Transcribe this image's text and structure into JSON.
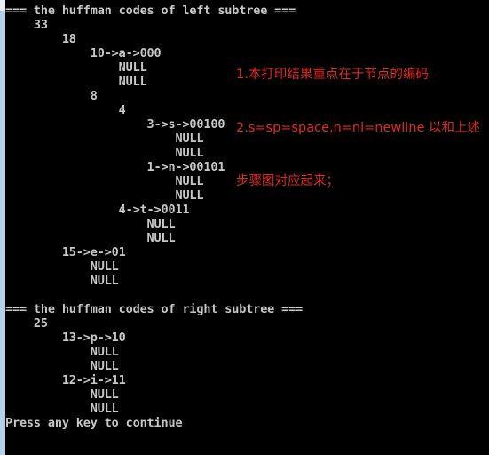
{
  "window": {
    "type": "console",
    "background_color": "#000000",
    "text_color": "#c8c8c8",
    "chrome_edge_color": "#b6d0ea",
    "chrome_edge_highlight_color": "#e7eef6"
  },
  "console": {
    "lines": [
      "=== the huffman codes of left subtree ===",
      "    33",
      "        18",
      "            10->a->000",
      "                NULL",
      "                NULL",
      "            8",
      "                4",
      "                    3->s->00100",
      "                        NULL",
      "                        NULL",
      "                    1->n->00101",
      "                        NULL",
      "                        NULL",
      "                4->t->0011",
      "                    NULL",
      "                    NULL",
      "        15->e->01",
      "            NULL",
      "            NULL",
      "",
      "=== the huffman codes of right subtree ===",
      "    25",
      "        13->p->10",
      "            NULL",
      "            NULL",
      "        12->i->11",
      "            NULL",
      "            NULL",
      "Press any key to continue"
    ],
    "text": "=== the huffman codes of left subtree ===\n    33\n        18\n            10->a->000\n                NULL\n                NULL\n            8\n                4\n                    3->s->00100\n                        NULL\n                        NULL\n                    1->n->00101\n                        NULL\n                        NULL\n                4->t->0011\n                    NULL\n                    NULL\n        15->e->01\n            NULL\n            NULL\n\n=== the huffman codes of right subtree ===\n    25\n        13->p->10\n            NULL\n            NULL\n        12->i->11\n            NULL\n            NULL\nPress any key to continue",
    "headers": {
      "left_subtree": "=== the huffman codes of left subtree ===",
      "right_subtree": "=== the huffman codes of right subtree ==="
    },
    "prompt": "Press any key to continue",
    "nodes": [
      {
        "weight": "33",
        "symbol": "",
        "code": "",
        "indent": 4
      },
      {
        "weight": "18",
        "symbol": "",
        "code": "",
        "indent": 8
      },
      {
        "weight": "10",
        "symbol": "a",
        "code": "000",
        "indent": 12
      },
      {
        "weight": "8",
        "symbol": "",
        "code": "",
        "indent": 12
      },
      {
        "weight": "4",
        "symbol": "",
        "code": "",
        "indent": 16
      },
      {
        "weight": "3",
        "symbol": "s",
        "code": "00100",
        "indent": 20
      },
      {
        "weight": "1",
        "symbol": "n",
        "code": "00101",
        "indent": 20
      },
      {
        "weight": "4",
        "symbol": "t",
        "code": "0011",
        "indent": 16
      },
      {
        "weight": "15",
        "symbol": "e",
        "code": "01",
        "indent": 8
      },
      {
        "weight": "25",
        "symbol": "",
        "code": "",
        "indent": 4
      },
      {
        "weight": "13",
        "symbol": "p",
        "code": "10",
        "indent": 8
      },
      {
        "weight": "12",
        "symbol": "i",
        "code": "11",
        "indent": 8
      }
    ],
    "null_label": "NULL"
  },
  "annotation": {
    "color": "#e02b22",
    "line1": "1.本打印结果重点在于节点的编码",
    "line2": "2.s=sp=space,n=nl=newline 以和上述",
    "line3": "步骤图对应起来；"
  }
}
